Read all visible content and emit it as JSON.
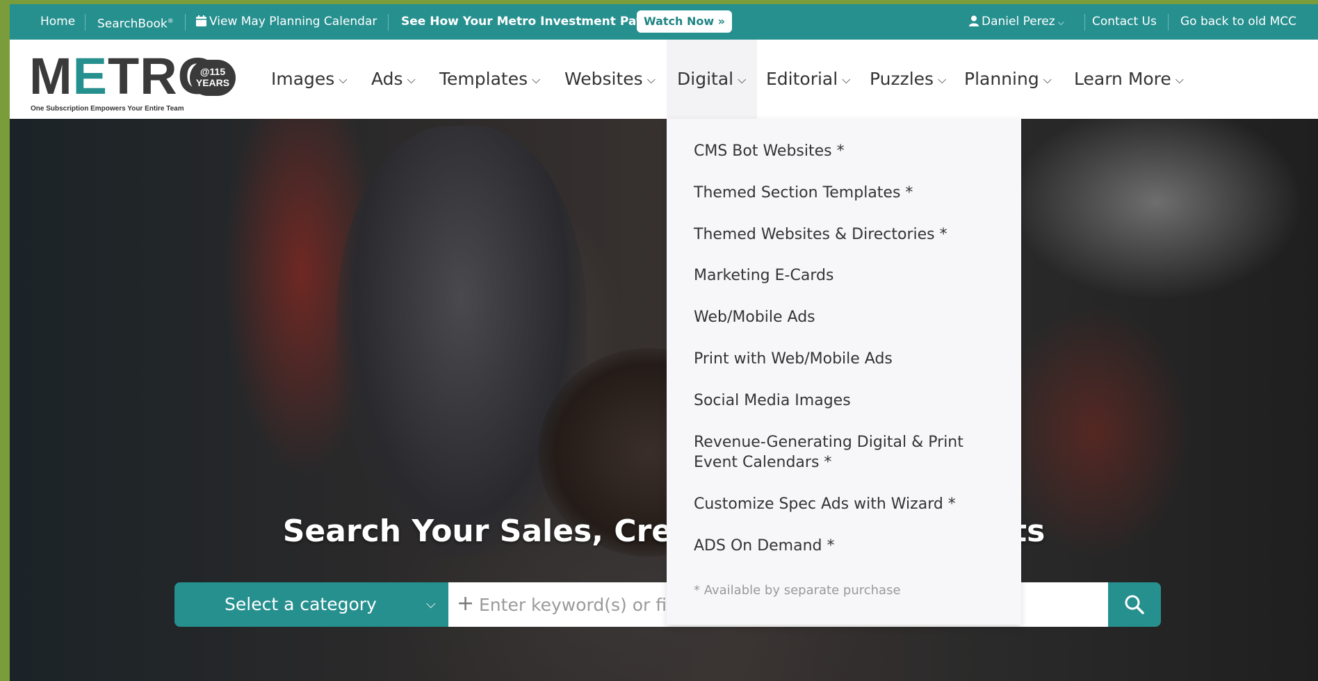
{
  "topbar": {
    "home": "Home",
    "searchbook": "SearchBook",
    "searchbook_mark": "®",
    "calendar_link": "View May Planning Calendar",
    "promo": "See How Your Metro Investment Pays",
    "watch_button": "Watch Now »",
    "user": "Daniel Perez",
    "contact": "Contact Us",
    "old_site": "Go back to old MCC"
  },
  "logo": {
    "word_m": "M",
    "word_e": "E",
    "word_tro": "TRO",
    "badge_line1": "@115",
    "badge_line2": "YEARS",
    "tagline": "One Subscription Empowers Your Entire Team"
  },
  "nav": {
    "items": [
      "Images",
      "Ads",
      "Templates",
      "Websites",
      "Digital",
      "Editorial",
      "Puzzles",
      "Planning",
      "Learn More"
    ],
    "active": "Digital"
  },
  "dropdown": {
    "items": [
      "CMS Bot Websites *",
      "Themed Section Templates *",
      "Themed Websites & Directories *",
      "Marketing E-Cards",
      "Web/Mobile Ads",
      "Print with Web/Mobile Ads",
      "Social Media Images",
      "Revenue-Generating Digital & Print Event Calendars *",
      "Customize Spec Ads with Wizard *",
      "ADS On Demand *"
    ],
    "note": "* Available by separate purchase"
  },
  "hero": {
    "title": "Search Your Sales, Creative & Digital Assets"
  },
  "search": {
    "category_label": "Select a category",
    "placeholder": "Enter keyword(s) or file name"
  },
  "colors": {
    "teal": "#26908f",
    "dark": "#3a3a3a"
  }
}
